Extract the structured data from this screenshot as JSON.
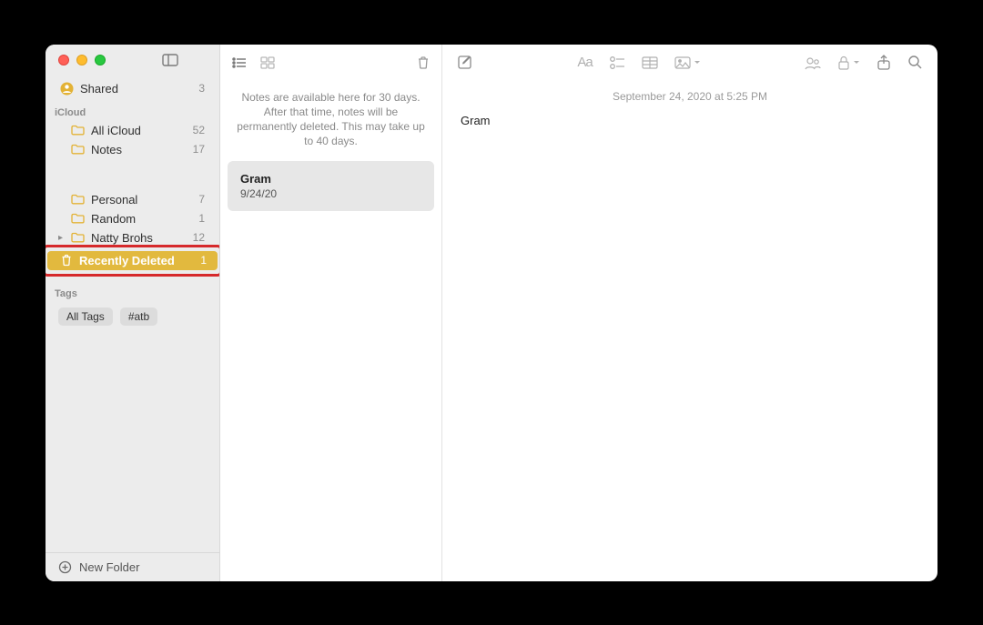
{
  "sidebar": {
    "shared": {
      "label": "Shared",
      "count": 3
    },
    "section_icloud": "iCloud",
    "items": [
      {
        "label": "All iCloud",
        "count": 52
      },
      {
        "label": "Notes",
        "count": 17
      },
      {
        "label": "Personal",
        "count": 7
      },
      {
        "label": "Random",
        "count": 1
      },
      {
        "label": "Natty Brohs",
        "count": 12
      },
      {
        "label": "Recently Deleted",
        "count": 1
      }
    ],
    "tags_header": "Tags",
    "tags": [
      "All Tags",
      "#atb"
    ],
    "new_folder": "New Folder"
  },
  "list": {
    "info": "Notes are available here for 30 days. After that time, notes will be permanently deleted. This may take up to 40 days.",
    "notes": [
      {
        "title": "Gram",
        "date": "9/24/20"
      }
    ]
  },
  "content": {
    "timestamp": "September 24, 2020 at 5:25 PM",
    "body": "Gram"
  }
}
